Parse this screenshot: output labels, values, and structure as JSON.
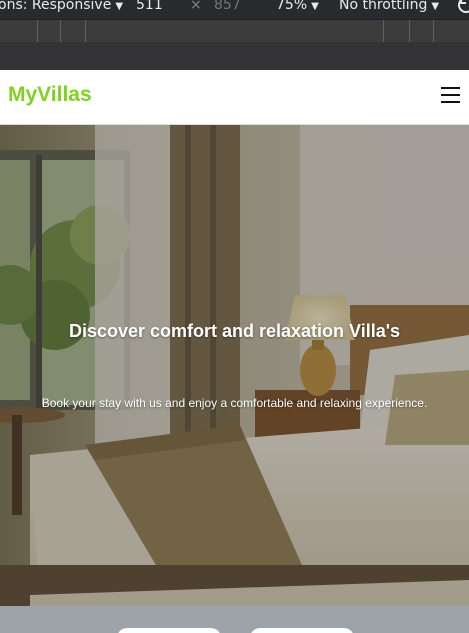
{
  "devtools": {
    "dimensions_label": "ons: Responsive",
    "width_value": "511",
    "times_symbol": "×",
    "height_value": "857",
    "zoom_label": "75%",
    "throttle_label": "No throttling",
    "caret": "▼",
    "rotate_icon": "rotate-icon"
  },
  "navbar": {
    "brand": "MyVillas",
    "brand_color": "#7ed321",
    "menu_icon": "hamburger-menu-icon"
  },
  "hero": {
    "title": "Discover comfort and relaxation Villa's",
    "subtitle": "Book your stay with us and enjoy a comfortable and relaxing experience."
  }
}
